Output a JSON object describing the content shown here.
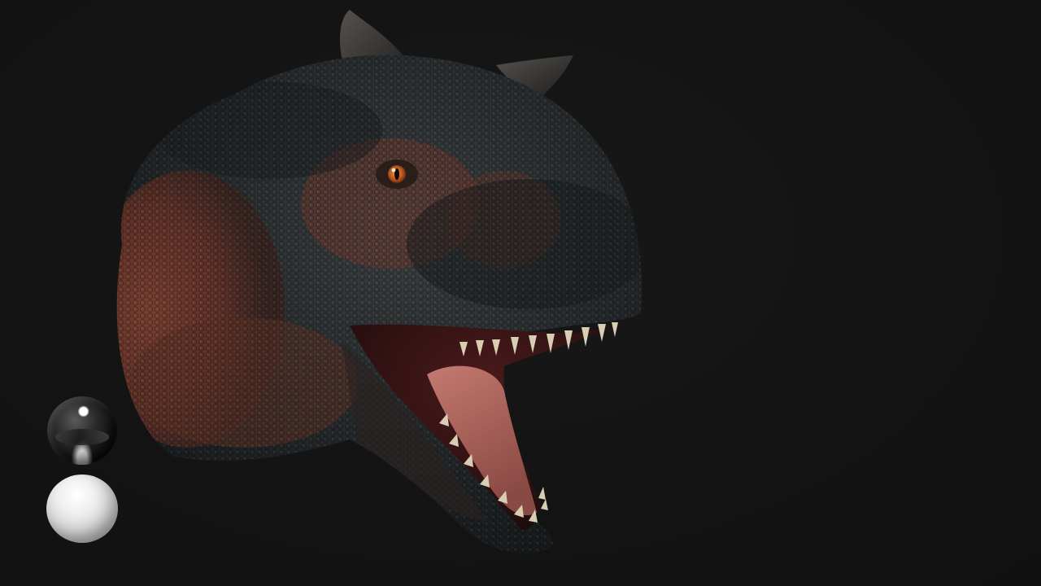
{
  "scene": {
    "subject": "carnotaurus-head-render",
    "background_color": "#141414",
    "palette": {
      "skin_dark": "#1f2325",
      "skin_mid": "#3a3d3c",
      "skin_red": "#7a3a2c",
      "mouth_inner": "#6b2a2a",
      "tongue": "#b86a64",
      "teeth": "#d8ceb4",
      "horn": "#2b2a28",
      "eye": "#c2601e"
    },
    "material_previews": [
      {
        "name": "chrome-sphere",
        "color": "#1a1a1a"
      },
      {
        "name": "clay-sphere",
        "color": "#e8e8e8"
      }
    ]
  }
}
